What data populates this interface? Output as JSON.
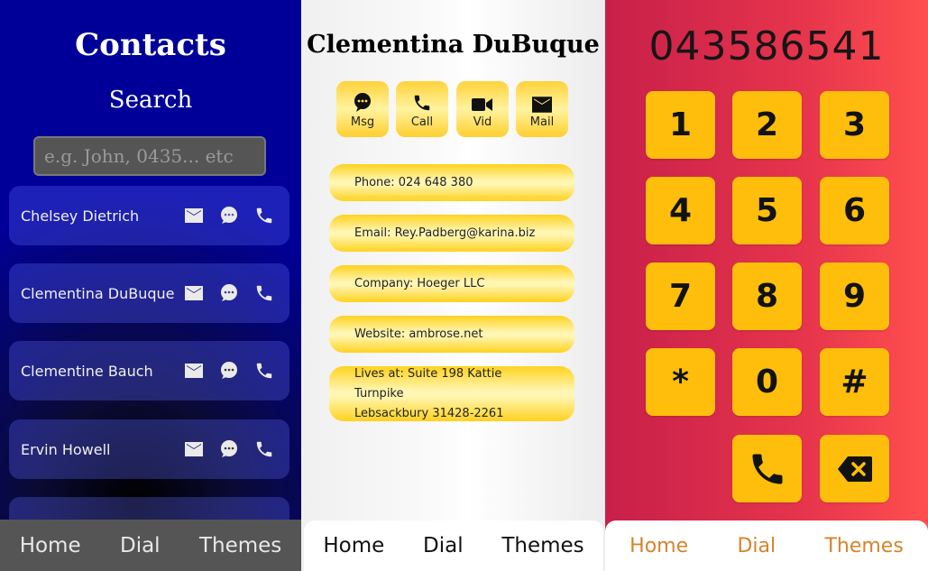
{
  "contacts_panel": {
    "title": "Contacts",
    "subtitle": "Search",
    "search_placeholder": "e.g. John, 0435... etc",
    "contacts": [
      {
        "name": "Chelsey Dietrich"
      },
      {
        "name": "Clementina DuBuque"
      },
      {
        "name": "Clementine Bauch"
      },
      {
        "name": "Ervin Howell"
      },
      {
        "name": ""
      }
    ],
    "contact_icons": [
      "mail-icon",
      "chat-icon",
      "phone-icon"
    ],
    "nav": {
      "home": "Home",
      "dial": "Dial",
      "themes": "Themes"
    },
    "colors": {
      "bg_top": "#000099",
      "nav_bg": "#555555"
    }
  },
  "detail_panel": {
    "name": "Clementina DuBuque",
    "actions": [
      {
        "label": "Msg",
        "icon": "chat-icon"
      },
      {
        "label": "Call",
        "icon": "phone-icon"
      },
      {
        "label": "Vid",
        "icon": "video-icon"
      },
      {
        "label": "Mail",
        "icon": "mail-icon"
      }
    ],
    "fields": {
      "phone": "Phone: 024 648 380",
      "email": "Email: Rey.Padberg@karina.biz",
      "company": "Company: Hoeger LLC",
      "website": "Website: ambrose.net",
      "address_line1": "Lives at: Suite 198 Kattie Turnpike",
      "address_line2": "Lebsackbury 31428-2261"
    },
    "nav": {
      "home": "Home",
      "dial": "Dial",
      "themes": "Themes"
    },
    "colors": {
      "accent": "#ffd21f"
    }
  },
  "dial_panel": {
    "number": "043586541",
    "keys": [
      "1",
      "2",
      "3",
      "4",
      "5",
      "6",
      "7",
      "8",
      "9",
      "*",
      "0",
      "#"
    ],
    "call_icon": "phone-icon",
    "backspace_icon": "backspace-icon",
    "nav": {
      "home": "Home",
      "dial": "Dial",
      "themes": "Themes"
    },
    "colors": {
      "key": "#ffbe0b",
      "nav_text": "#d4842c"
    }
  }
}
